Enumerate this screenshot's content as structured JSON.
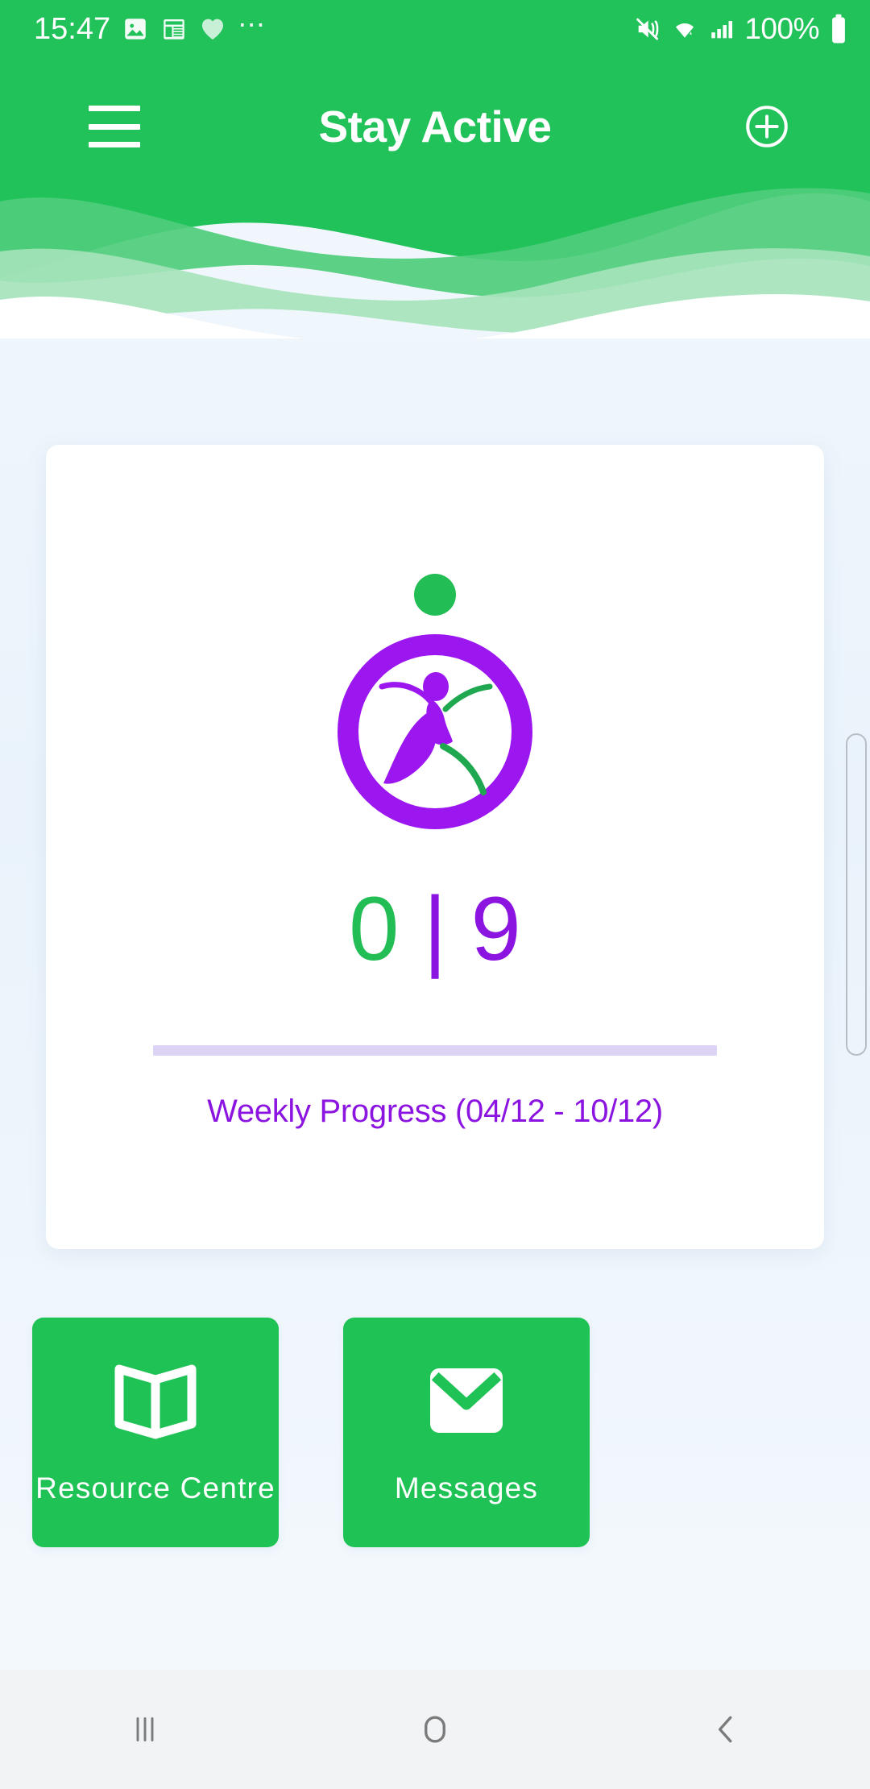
{
  "status_bar": {
    "time": "15:47",
    "battery_percent": "100%",
    "left_icons": [
      "image-icon",
      "calendar-note-icon",
      "heart-icon",
      "more-dots-icon"
    ],
    "right_icons": [
      "mute-vibrate-icon",
      "wifi-icon",
      "cellular-signal-icon",
      "battery-icon"
    ]
  },
  "header": {
    "title": "Stay Active",
    "menu_icon": "hamburger-menu-icon",
    "add_icon": "plus-circle-icon",
    "background_color": "#21c25a"
  },
  "card": {
    "logo": {
      "name": "stay-active-logo",
      "dot_color": "#22bd55",
      "ring_color": "#9b16ef",
      "figure_accent_color": "#1fa84f"
    },
    "score": {
      "completed": "0",
      "separator": "|",
      "goal": "9",
      "completed_color": "#22bd55",
      "goal_color": "#8b14e0"
    },
    "progress_bar_color": "#ddd3f5",
    "progress_label": "Weekly Progress (04/12 - 10/12)",
    "progress_label_color": "#8b14e0"
  },
  "tiles": [
    {
      "label": "Resource Centre",
      "icon": "open-book-icon",
      "color": "#1fc255"
    },
    {
      "label": "Messages",
      "icon": "envelope-icon",
      "color": "#1fc255"
    }
  ],
  "nav_bar": {
    "recents_icon": "recents-icon",
    "home_icon": "home-icon",
    "back_icon": "back-icon"
  }
}
